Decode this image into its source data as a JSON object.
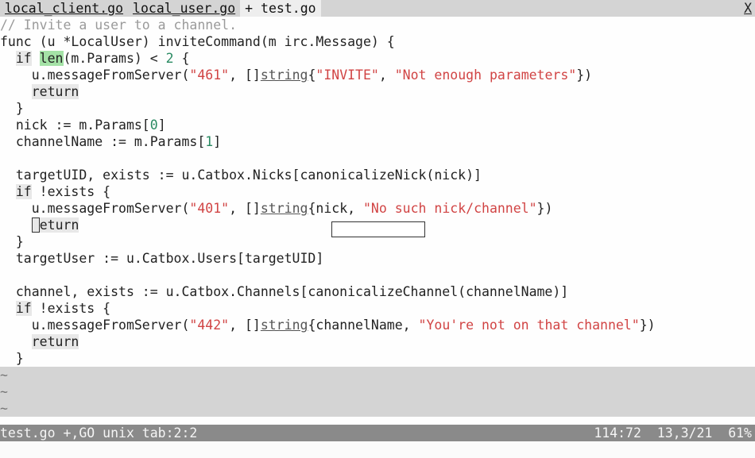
{
  "tabs": {
    "items": [
      {
        "label": "local_client.go",
        "active": false,
        "prefix": " "
      },
      {
        "label": "local_user.go",
        "active": false,
        "prefix": " "
      },
      {
        "label": "test.go",
        "active": true,
        "prefix": " + "
      }
    ],
    "close_label": "X"
  },
  "code": {
    "l1_comment": "// Invite a user to a channel.",
    "l2_a": "func (u *LocalUser) inviteCommand(m irc.Message) {",
    "l3_a": "  ",
    "l3_if": "if",
    "l3_b": " ",
    "l3_len": "len",
    "l3_c": "(m.Params) < ",
    "l3_num": "2",
    "l3_d": " {",
    "l4_a": "    u.messageFromServer(",
    "l4_s1": "\"461\"",
    "l4_b": ", []",
    "l4_type": "string",
    "l4_c": "{",
    "l4_s2": "\"INVITE\"",
    "l4_d": ", ",
    "l4_s3": "\"Not enough parameters\"",
    "l4_e": "})",
    "l5_a": "    ",
    "l5_ret": "return",
    "l6": "  }",
    "l7_a": "  nick := m.Params[",
    "l7_num": "0",
    "l7_b": "]",
    "l8_a": "  channelName := m.Params[",
    "l8_num": "1",
    "l8_b": "]",
    "l9_blank": "",
    "l10": "  targetUID, exists := u.Catbox.Nicks[canonicalizeNick(nick)]",
    "l11_a": "  ",
    "l11_if": "if",
    "l11_b": " !exists {",
    "l12_a": "    u.messageFromServer(",
    "l12_s1": "\"401\"",
    "l12_b": ", []",
    "l12_type": "string",
    "l12_c": "{nick, ",
    "l12_s2": "\"No such nick/channel\"",
    "l12_d": "})",
    "l13_a": "    ",
    "l13_ret_rest": "eturn",
    "l14": "  }",
    "l15": "  targetUser := u.Catbox.Users[targetUID]",
    "l16_blank": "",
    "l17": "  channel, exists := u.Catbox.Channels[canonicalizeChannel(channelName)]",
    "l18_a": "  ",
    "l18_if": "if",
    "l18_b": " !exists {",
    "l19_a": "    u.messageFromServer(",
    "l19_s1": "\"442\"",
    "l19_b": ", []",
    "l19_type": "string",
    "l19_c": "{channelName, ",
    "l19_s2": "\"You're not on that channel\"",
    "l19_d": "})",
    "l20_a": "    ",
    "l20_ret": "return",
    "l21": "  }",
    "tilde": "~"
  },
  "status": {
    "left": "test.go +,GO unix tab:2:2",
    "right": "114:72  13,3/21  61%"
  },
  "cmdline": ""
}
